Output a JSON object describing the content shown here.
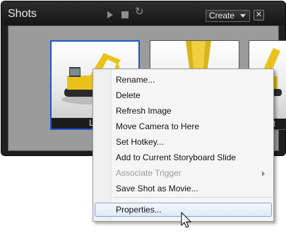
{
  "panel": {
    "title": "Shots",
    "create_label": "Create",
    "close_glyph": "✕",
    "refresh_glyph": "↻"
  },
  "shots": [
    {
      "label": "Lef",
      "selected": true
    },
    {
      "label": "",
      "selected": false
    },
    {
      "label": "ght",
      "selected": false
    }
  ],
  "context_menu": {
    "items": [
      {
        "label": "Rename...",
        "enabled": true
      },
      {
        "label": "Delete",
        "enabled": true
      },
      {
        "label": "Refresh Image",
        "enabled": true
      },
      {
        "label": "Move Camera to Here",
        "enabled": true
      },
      {
        "label": "Set Hotkey...",
        "enabled": true
      },
      {
        "label": "Add to Current Storyboard Slide",
        "enabled": true
      },
      {
        "label": "Associate Trigger",
        "enabled": false,
        "submenu": true
      },
      {
        "label": "Save Shot as Movie...",
        "enabled": true
      },
      {
        "label": "Properties...",
        "enabled": true,
        "hovered": true
      }
    ]
  },
  "colors": {
    "selection_border": "#1d56c8",
    "menu_highlight": "#dde9f7",
    "machine_yellow": "#e8c21a"
  }
}
